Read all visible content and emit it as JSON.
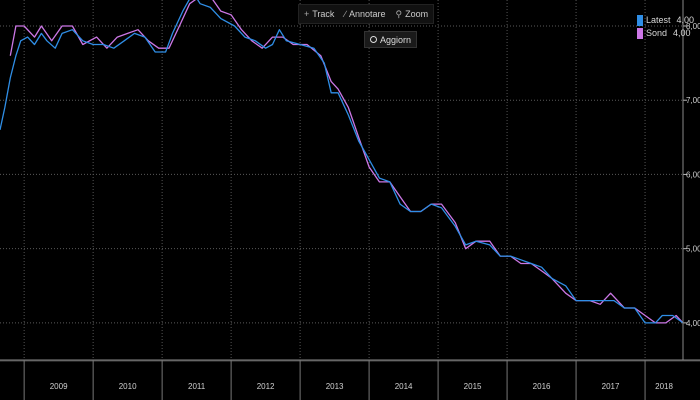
{
  "toolbar": {
    "track_label": "Track",
    "annotate_label": "Annotare",
    "zoom_label": "Zoom",
    "refresh_label": "Aggiorn"
  },
  "legend": [
    {
      "name": "Latest",
      "value": "4,00",
      "color": "#2f8ee6"
    },
    {
      "name": "Sond",
      "value": "4,00",
      "color": "#cc77e6"
    }
  ],
  "chart_data": {
    "type": "line",
    "title": "",
    "xlabel": "",
    "ylabel": "",
    "xlim": [
      2008.65,
      2018.55
    ],
    "ylim": [
      3.5,
      8.35
    ],
    "x_ticks": [
      "2009",
      "2010",
      "2011",
      "2012",
      "2013",
      "2014",
      "2015",
      "2016",
      "2017",
      "2018"
    ],
    "y_ticks": [
      "4,00",
      "5,00",
      "6,00",
      "7,00",
      "8,00"
    ],
    "y_tick_values": [
      4,
      5,
      6,
      7,
      8
    ],
    "grid": true,
    "legend_position": "top-right",
    "series": [
      {
        "name": "Latest",
        "color": "#2f8ee6",
        "points": [
          [
            2008.65,
            6.6
          ],
          [
            2008.72,
            6.9
          ],
          [
            2008.8,
            7.3
          ],
          [
            2008.88,
            7.6
          ],
          [
            2008.95,
            7.8
          ],
          [
            2009.05,
            7.85
          ],
          [
            2009.15,
            7.75
          ],
          [
            2009.25,
            7.9
          ],
          [
            2009.33,
            7.8
          ],
          [
            2009.45,
            7.7
          ],
          [
            2009.55,
            7.9
          ],
          [
            2009.7,
            7.95
          ],
          [
            2009.85,
            7.8
          ],
          [
            2010.0,
            7.75
          ],
          [
            2010.15,
            7.75
          ],
          [
            2010.3,
            7.7
          ],
          [
            2010.45,
            7.8
          ],
          [
            2010.6,
            7.9
          ],
          [
            2010.75,
            7.85
          ],
          [
            2010.9,
            7.65
          ],
          [
            2011.05,
            7.65
          ],
          [
            2011.15,
            7.9
          ],
          [
            2011.3,
            8.2
          ],
          [
            2011.45,
            8.45
          ],
          [
            2011.55,
            8.3
          ],
          [
            2011.7,
            8.25
          ],
          [
            2011.85,
            8.1
          ],
          [
            2012.05,
            8.0
          ],
          [
            2012.2,
            7.85
          ],
          [
            2012.35,
            7.8
          ],
          [
            2012.5,
            7.7
          ],
          [
            2012.6,
            7.75
          ],
          [
            2012.7,
            7.95
          ],
          [
            2012.8,
            7.8
          ],
          [
            2013.0,
            7.75
          ],
          [
            2013.2,
            7.7
          ],
          [
            2013.35,
            7.5
          ],
          [
            2013.45,
            7.1
          ],
          [
            2013.55,
            7.1
          ],
          [
            2013.7,
            6.8
          ],
          [
            2013.85,
            6.45
          ],
          [
            2014.0,
            6.2
          ],
          [
            2014.15,
            5.95
          ],
          [
            2014.3,
            5.9
          ],
          [
            2014.45,
            5.6
          ],
          [
            2014.6,
            5.5
          ],
          [
            2014.75,
            5.5
          ],
          [
            2014.9,
            5.6
          ],
          [
            2015.05,
            5.55
          ],
          [
            2015.25,
            5.3
          ],
          [
            2015.4,
            5.05
          ],
          [
            2015.55,
            5.1
          ],
          [
            2015.75,
            5.05
          ],
          [
            2015.9,
            4.9
          ],
          [
            2016.05,
            4.9
          ],
          [
            2016.2,
            4.85
          ],
          [
            2016.35,
            4.8
          ],
          [
            2016.5,
            4.75
          ],
          [
            2016.65,
            4.6
          ],
          [
            2016.85,
            4.5
          ],
          [
            2017.0,
            4.3
          ],
          [
            2017.2,
            4.3
          ],
          [
            2017.4,
            4.3
          ],
          [
            2017.55,
            4.3
          ],
          [
            2017.7,
            4.2
          ],
          [
            2017.85,
            4.2
          ],
          [
            2018.0,
            4.0
          ],
          [
            2018.15,
            4.0
          ],
          [
            2018.25,
            4.1
          ],
          [
            2018.4,
            4.1
          ],
          [
            2018.55,
            4.0
          ]
        ]
      },
      {
        "name": "Sond",
        "color": "#cc77e6",
        "points": [
          [
            2008.8,
            7.6
          ],
          [
            2008.88,
            8.0
          ],
          [
            2009.0,
            8.0
          ],
          [
            2009.15,
            7.85
          ],
          [
            2009.25,
            8.0
          ],
          [
            2009.4,
            7.8
          ],
          [
            2009.55,
            8.0
          ],
          [
            2009.7,
            8.0
          ],
          [
            2009.85,
            7.75
          ],
          [
            2010.05,
            7.85
          ],
          [
            2010.2,
            7.7
          ],
          [
            2010.35,
            7.85
          ],
          [
            2010.5,
            7.9
          ],
          [
            2010.65,
            7.95
          ],
          [
            2010.8,
            7.8
          ],
          [
            2010.95,
            7.7
          ],
          [
            2011.1,
            7.7
          ],
          [
            2011.25,
            8.0
          ],
          [
            2011.4,
            8.3
          ],
          [
            2011.55,
            8.4
          ],
          [
            2011.7,
            8.4
          ],
          [
            2011.85,
            8.2
          ],
          [
            2012.0,
            8.15
          ],
          [
            2012.15,
            7.95
          ],
          [
            2012.3,
            7.8
          ],
          [
            2012.45,
            7.7
          ],
          [
            2012.6,
            7.85
          ],
          [
            2012.75,
            7.85
          ],
          [
            2012.9,
            7.75
          ],
          [
            2013.1,
            7.75
          ],
          [
            2013.3,
            7.6
          ],
          [
            2013.45,
            7.25
          ],
          [
            2013.55,
            7.15
          ],
          [
            2013.7,
            6.9
          ],
          [
            2013.85,
            6.5
          ],
          [
            2014.0,
            6.1
          ],
          [
            2014.15,
            5.9
          ],
          [
            2014.3,
            5.9
          ],
          [
            2014.45,
            5.7
          ],
          [
            2014.6,
            5.5
          ],
          [
            2014.75,
            5.5
          ],
          [
            2014.9,
            5.6
          ],
          [
            2015.05,
            5.6
          ],
          [
            2015.25,
            5.35
          ],
          [
            2015.4,
            5.0
          ],
          [
            2015.55,
            5.1
          ],
          [
            2015.75,
            5.1
          ],
          [
            2015.9,
            4.9
          ],
          [
            2016.05,
            4.9
          ],
          [
            2016.2,
            4.8
          ],
          [
            2016.35,
            4.8
          ],
          [
            2016.5,
            4.7
          ],
          [
            2016.65,
            4.6
          ],
          [
            2016.85,
            4.4
          ],
          [
            2017.0,
            4.3
          ],
          [
            2017.2,
            4.3
          ],
          [
            2017.35,
            4.25
          ],
          [
            2017.5,
            4.4
          ],
          [
            2017.7,
            4.2
          ],
          [
            2017.85,
            4.2
          ],
          [
            2018.0,
            4.1
          ],
          [
            2018.15,
            4.0
          ],
          [
            2018.3,
            4.0
          ],
          [
            2018.45,
            4.1
          ],
          [
            2018.55,
            4.0
          ]
        ]
      }
    ]
  }
}
